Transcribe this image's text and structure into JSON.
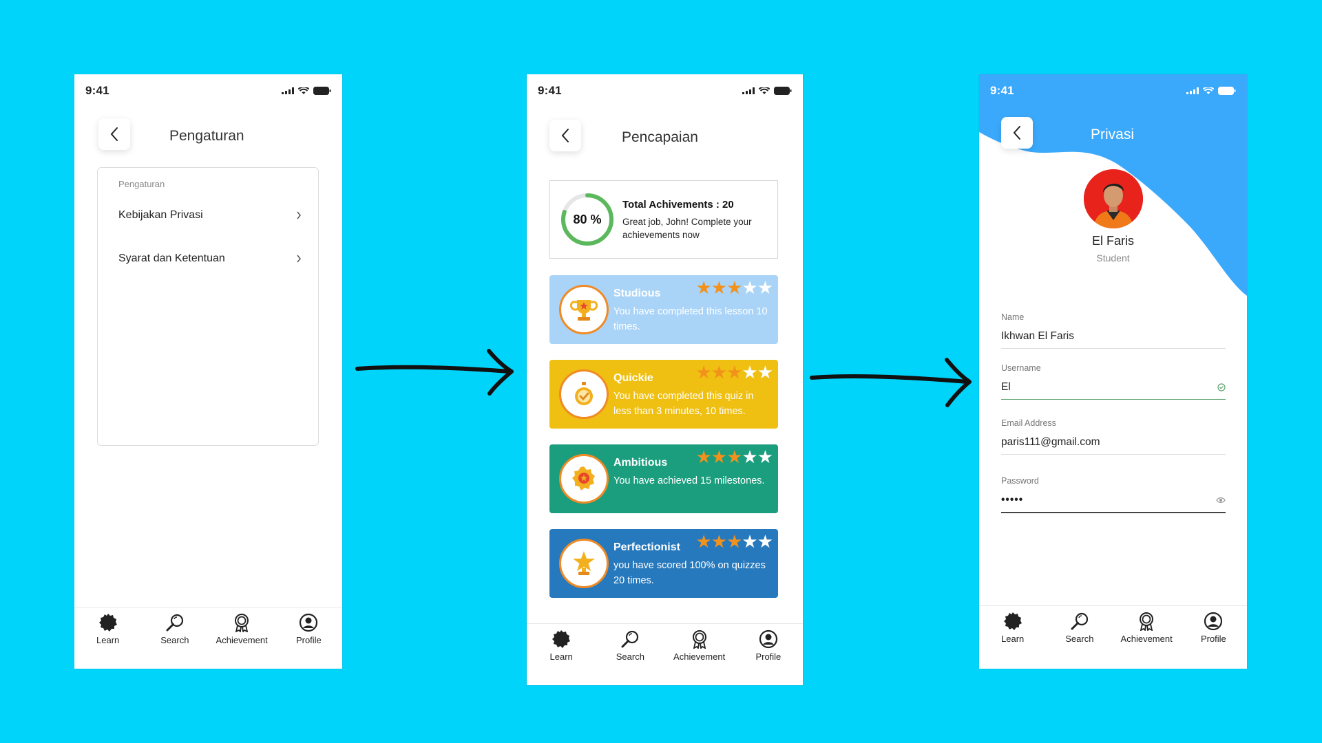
{
  "status_time": "9:41",
  "nav": {
    "learn": "Learn",
    "search": "Search",
    "achievement": "Achievement",
    "profile": "Profile"
  },
  "settings_screen": {
    "title": "Pengaturan",
    "caption": "Pengaturan",
    "items": [
      {
        "label": "Kebijakan Privasi"
      },
      {
        "label": "Syarat dan Ketentuan"
      }
    ]
  },
  "achievements_screen": {
    "title": "Pencapaian",
    "total": {
      "percent_label": "80 %",
      "progress": 0.8,
      "title": "Total Achivements : 20",
      "description": "Great job, John! Complete your achievements now"
    },
    "cards": [
      {
        "name": "Studious",
        "text": "You have completed this lesson 10 times.",
        "stars_earned": 3,
        "stars_total": 5,
        "color": "#a9d4f7",
        "icon": "trophy-icon"
      },
      {
        "name": "Quickie",
        "text": "You have completed this quiz in less than 3 minutes, 10 times.",
        "stars_earned": 3,
        "stars_total": 5,
        "color": "#efbf12",
        "icon": "stopwatch-icon"
      },
      {
        "name": "Ambitious",
        "text": "You have achieved 15 milestones.",
        "stars_earned": 3,
        "stars_total": 5,
        "color": "#1a9e7e",
        "icon": "medal-icon"
      },
      {
        "name": "Perfectionist",
        "text": "you have scored 100% on quizzes 20 times.",
        "stars_earned": 3,
        "stars_total": 5,
        "color": "#2779bd",
        "icon": "star-trophy-icon"
      }
    ]
  },
  "privacy_screen": {
    "title": "Privasi",
    "user_name": "El Faris",
    "user_role": "Student",
    "fields": {
      "name": {
        "label": "Name",
        "value": "Ikhwan El Faris"
      },
      "username": {
        "label": "Username",
        "value": "El"
      },
      "email": {
        "label": "Email Address",
        "value": "paris111@gmail.com"
      },
      "password": {
        "label": "Password",
        "value": "•••••"
      }
    }
  },
  "colors": {
    "background": "#00d4fa",
    "header_blue": "#3ba9fb",
    "ring_green": "#5cb85c",
    "star_orange": "#f2911b",
    "badge_ring": "#f08a24"
  }
}
